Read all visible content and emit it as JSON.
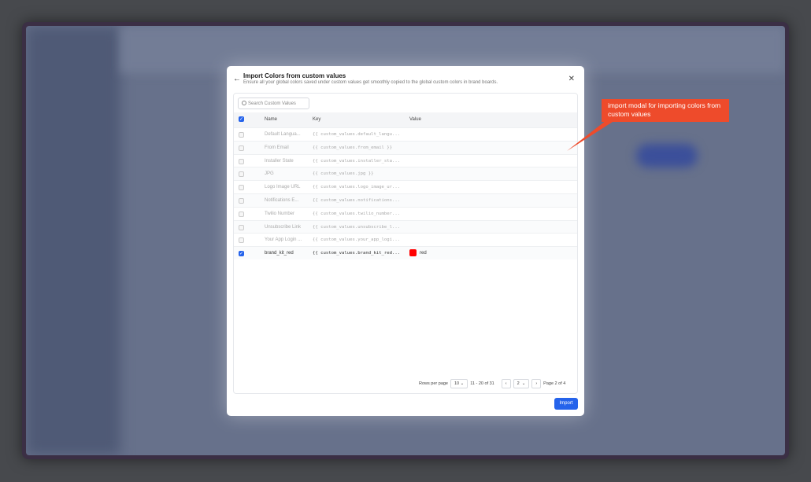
{
  "modal": {
    "title": "Import Colors from custom values",
    "subtitle": "Ensure all your global colors saved under custom values get smoothly copied to the global custom colors in brand boards.",
    "search_placeholder": "Search Custom Values",
    "import_label": "Import"
  },
  "table": {
    "headers": [
      "Name",
      "Key",
      "Value"
    ],
    "rows": [
      {
        "name": "Default Langua...",
        "key": "{{ custom_values.default_langu...",
        "value": "",
        "checked": false
      },
      {
        "name": "From Email",
        "key": "{{ custom_values.from_email }}",
        "value": "",
        "checked": false
      },
      {
        "name": "Installer State",
        "key": "{{ custom_values.installer_sta...",
        "value": "",
        "checked": false
      },
      {
        "name": "JPG",
        "key": "{{ custom_values.jpg }}",
        "value": "",
        "checked": false
      },
      {
        "name": "Logo Image URL",
        "key": "{{ custom_values.logo_image_ur...",
        "value": "",
        "checked": false
      },
      {
        "name": "Notifications E...",
        "key": "{{ custom_values.notifications...",
        "value": "",
        "checked": false
      },
      {
        "name": "Twilio Number",
        "key": "{{ custom_values.twilio_number...",
        "value": "",
        "checked": false
      },
      {
        "name": "Unsubscribe Link",
        "key": "{{ custom_values.unsubscribe_l...",
        "value": "",
        "checked": false
      },
      {
        "name": "Your App Login ...",
        "key": "{{ custom_values.your_app_logi...",
        "value": "",
        "checked": false
      },
      {
        "name": "brand_kit_red",
        "key": "{{ custom_values.brand_kit_red...",
        "value": "red",
        "swatch": "#ff0000",
        "checked": true
      }
    ]
  },
  "pagination": {
    "rows_per_page_label": "Rows per page",
    "rows_per_page": "10",
    "range": "11 - 20 of 31",
    "page": "2",
    "page_label": "Page 2 of 4"
  },
  "annotation": {
    "text": "import modal for importing colors from custom values",
    "color": "#ee4b2b"
  }
}
